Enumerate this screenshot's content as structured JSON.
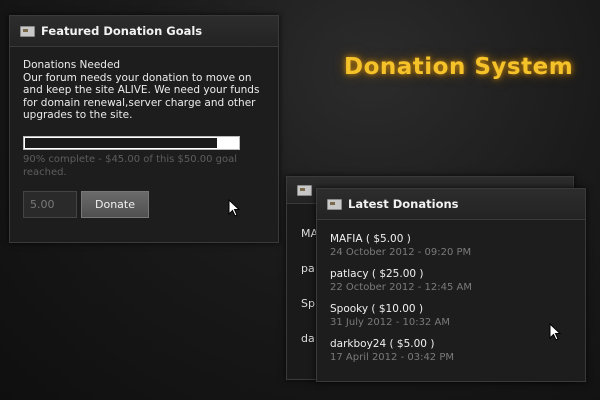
{
  "title": "Donation System",
  "goals_panel": {
    "header": "Featured Donation Goals",
    "heading": "Donations Needed",
    "description": "Our forum needs your donation to move on and keep the site ALIVE. We need your funds for domain renewal,server charge and other upgrades to the site.",
    "progress_fraction": 0.9,
    "progress_caption": "90% complete - $45.00 of this $50.00 goal reached.",
    "amount_value": "5.00",
    "donate_label": "Donate"
  },
  "back_panel": {
    "visible_fragments": [
      "MA",
      "pa",
      "Sp",
      "da"
    ]
  },
  "latest_panel": {
    "header": "Latest Donations",
    "items": [
      {
        "user": "MAFIA ( $5.00 )",
        "date": "24 October 2012 - 09:20 PM"
      },
      {
        "user": "patlacy ( $25.00 )",
        "date": "22 October 2012 - 12:45 AM"
      },
      {
        "user": "Spooky ( $10.00 )",
        "date": "31 July 2012 - 10:32 AM"
      },
      {
        "user": "darkboy24 ( $5.00 )",
        "date": "17 April 2012 - 03:42 PM"
      }
    ]
  },
  "colors": {
    "accent_title": "#f5c22a",
    "panel_bg": "#1d1d1d"
  }
}
